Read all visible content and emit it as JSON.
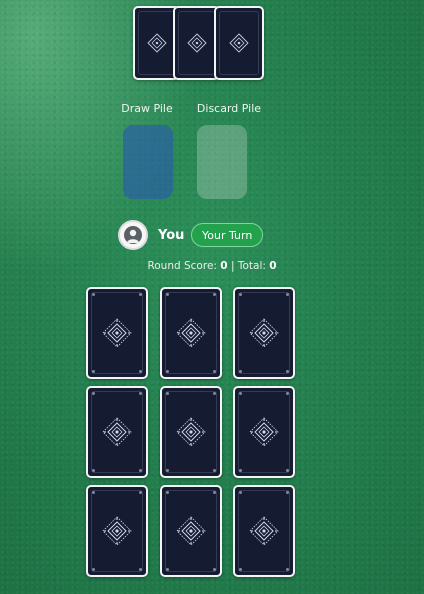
{
  "piles": {
    "draw_label": "Draw Pile",
    "discard_label": "Discard Pile"
  },
  "player": {
    "name": "You",
    "turn_badge": "Your Turn",
    "avatar_icon": "user-icon"
  },
  "score": {
    "round_label": "Round Score:",
    "round_value": "0",
    "separator": "|",
    "total_label": "Total:",
    "total_value": "0"
  },
  "opponent_cards": [
    {
      "face": "down"
    },
    {
      "face": "down"
    },
    {
      "face": "down"
    }
  ],
  "player_grid": {
    "rows": 3,
    "cols": 3,
    "cards": [
      {
        "face": "down"
      },
      {
        "face": "down"
      },
      {
        "face": "down"
      },
      {
        "face": "down"
      },
      {
        "face": "down"
      },
      {
        "face": "down"
      },
      {
        "face": "down"
      },
      {
        "face": "down"
      },
      {
        "face": "down"
      }
    ]
  },
  "colors": {
    "table": "#237f4e",
    "card_back": "#151c32",
    "card_border": "#f3f4f6",
    "turn_badge": "#23a14d",
    "draw_pile": "#285aaf"
  }
}
